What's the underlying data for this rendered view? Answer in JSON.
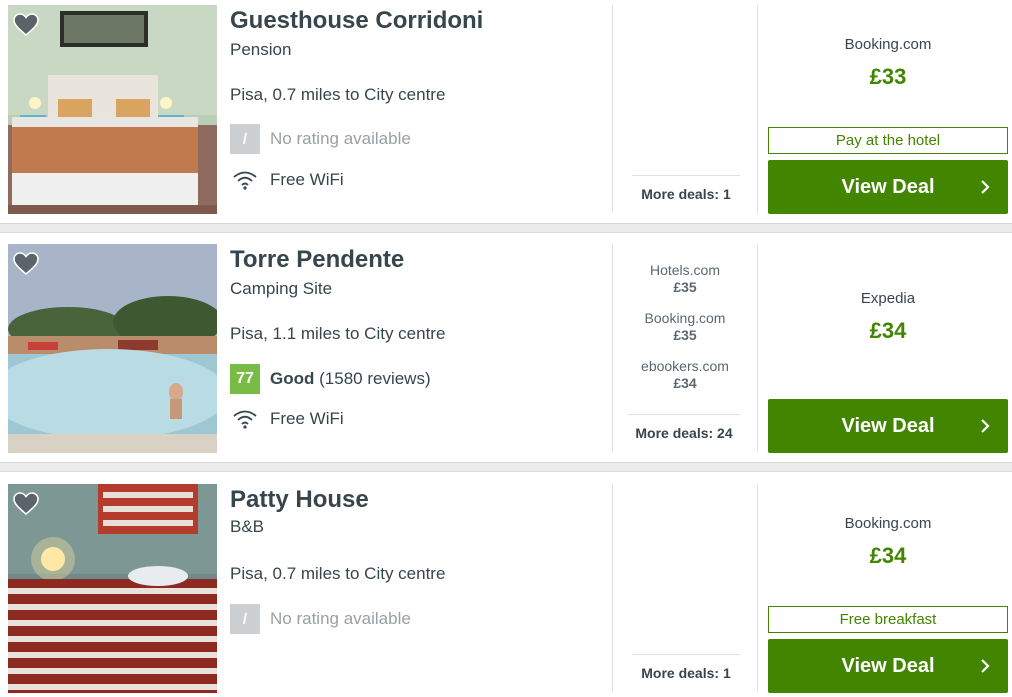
{
  "listings": [
    {
      "name": "Guesthouse Corridoni",
      "type": "Pension",
      "location": "Pisa, 0.7 miles to City centre",
      "rating_badge": "/",
      "rating_text": "No rating available",
      "amenity": "Free WiFi",
      "more_deals": "More deals: 1",
      "provider": "Booking.com",
      "price": "£33",
      "perk": "Pay at the hotel",
      "cta": "View Deal"
    },
    {
      "name": "Torre Pendente",
      "type": "Camping Site",
      "location": "Pisa, 1.1 miles to City centre",
      "rating_badge": "77",
      "rating_word": "Good",
      "rating_reviews": "(1580 reviews)",
      "amenity": "Free WiFi",
      "alt_deals": [
        {
          "site": "Hotels.com",
          "price": "£35"
        },
        {
          "site": "Booking.com",
          "price": "£35"
        },
        {
          "site": "ebookers.com",
          "price": "£34"
        }
      ],
      "more_deals": "More deals: 24",
      "provider": "Expedia",
      "price": "£34",
      "cta": "View Deal"
    },
    {
      "name": "Patty House",
      "type": "B&B",
      "location": "Pisa, 0.7 miles to City centre",
      "rating_badge": "/",
      "rating_text": "No rating available",
      "more_deals": "More deals: 1",
      "provider": "Booking.com",
      "price": "£34",
      "perk": "Free breakfast",
      "cta": "View Deal"
    }
  ],
  "colors": {
    "accent_green": "#428500",
    "rating_good": "#78bb45",
    "rating_none": "#cdd0d2",
    "text_dark": "#37454d"
  },
  "icons": [
    "heart-icon",
    "wifi-icon",
    "chevron-right-icon"
  ]
}
